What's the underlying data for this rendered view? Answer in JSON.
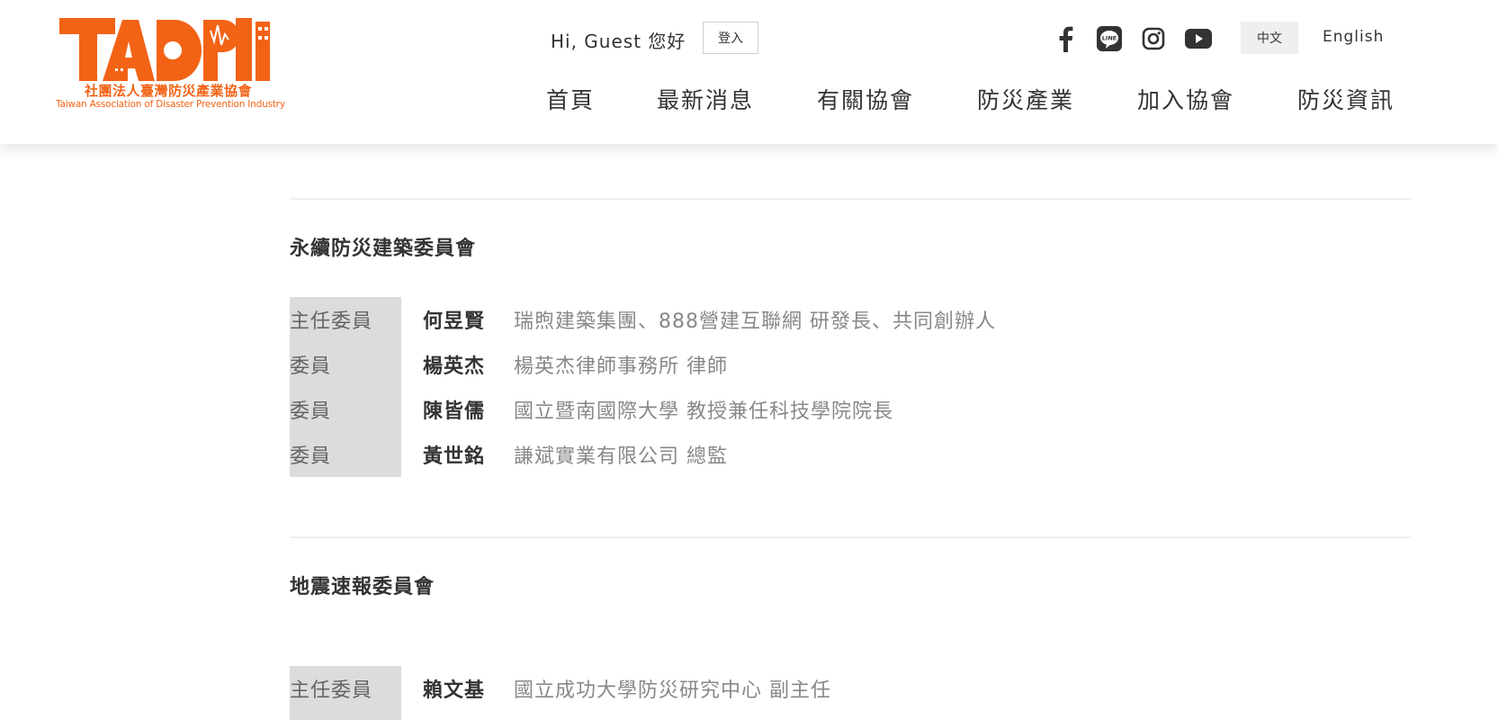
{
  "brand": {
    "logo_text": "TADPI",
    "name_zh": "社團法人臺灣防災產業協會",
    "name_en": "Taiwan Association of Disaster Prevention Industry",
    "color": "#f26316"
  },
  "header": {
    "greeting": "Hi, Guest 您好",
    "login_label": "登入",
    "social_icons": [
      "facebook-icon",
      "line-icon",
      "instagram-icon",
      "youtube-icon"
    ],
    "lang_zh": "中文",
    "lang_en": "English",
    "nav": [
      "首頁",
      "最新消息",
      "有關協會",
      "防災產業",
      "加入協會",
      "防災資訊"
    ]
  },
  "sections": [
    {
      "title": "永續防災建築委員會",
      "members": [
        {
          "role": "主任委員",
          "name": "何昱賢",
          "desc": "瑞煦建築集團、888營建互聯網  研發長、共同創辦人"
        },
        {
          "role": "委員",
          "name": "楊英杰",
          "desc": "楊英杰律師事務所 律師"
        },
        {
          "role": "委員",
          "name": "陳皆儒",
          "desc": "國立暨南國際大學 教授兼任科技學院院長"
        },
        {
          "role": "委員",
          "name": "黃世銘",
          "desc": "謙斌實業有限公司 總監"
        }
      ]
    },
    {
      "title": "地震速報委員會",
      "members": [
        {
          "role": "主任委員",
          "name": "賴文基",
          "desc": "國立成功大學防災研究中心 副主任"
        }
      ]
    }
  ]
}
